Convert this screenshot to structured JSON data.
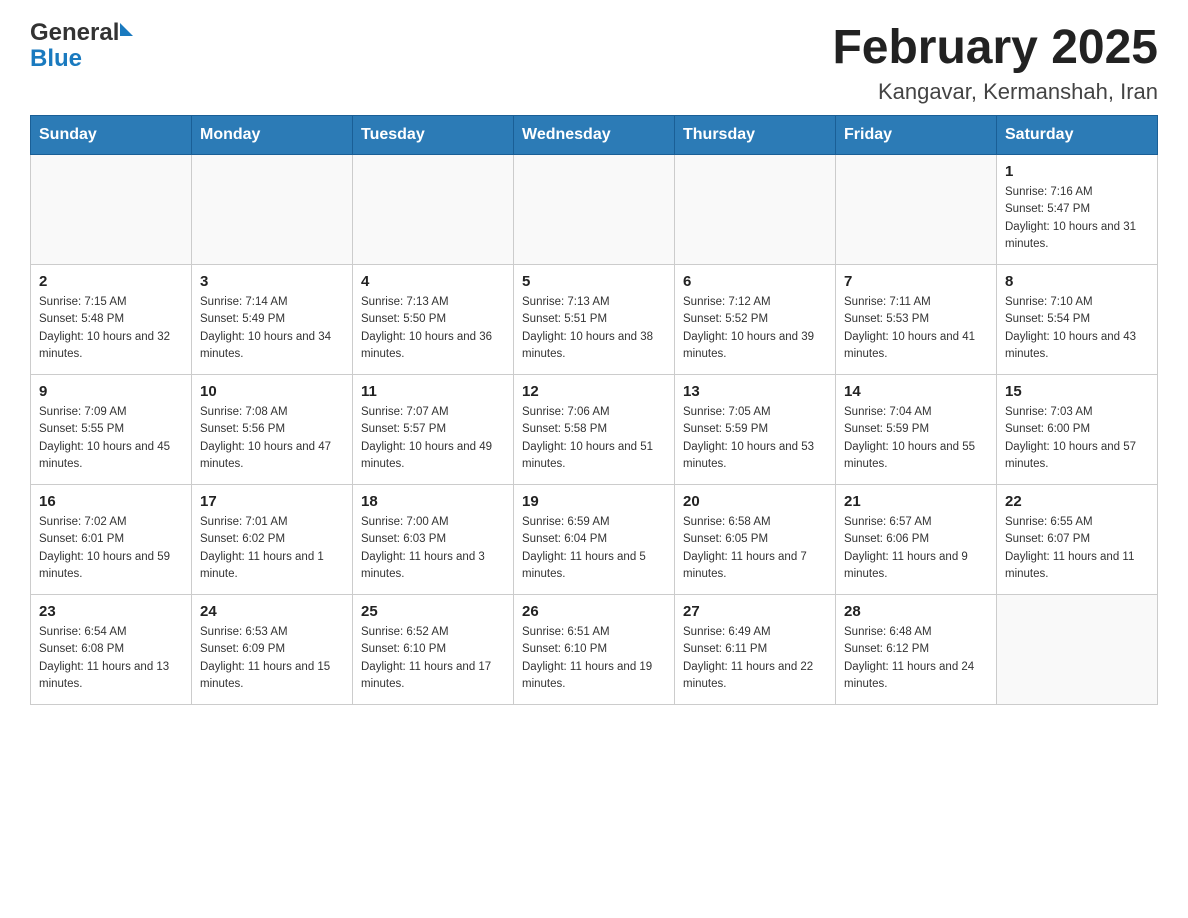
{
  "header": {
    "logo_line1": "General",
    "logo_line2": "Blue",
    "title": "February 2025",
    "subtitle": "Kangavar, Kermanshah, Iran"
  },
  "calendar": {
    "days_of_week": [
      "Sunday",
      "Monday",
      "Tuesday",
      "Wednesday",
      "Thursday",
      "Friday",
      "Saturday"
    ],
    "weeks": [
      [
        {
          "day": "",
          "info": ""
        },
        {
          "day": "",
          "info": ""
        },
        {
          "day": "",
          "info": ""
        },
        {
          "day": "",
          "info": ""
        },
        {
          "day": "",
          "info": ""
        },
        {
          "day": "",
          "info": ""
        },
        {
          "day": "1",
          "info": "Sunrise: 7:16 AM\nSunset: 5:47 PM\nDaylight: 10 hours and 31 minutes."
        }
      ],
      [
        {
          "day": "2",
          "info": "Sunrise: 7:15 AM\nSunset: 5:48 PM\nDaylight: 10 hours and 32 minutes."
        },
        {
          "day": "3",
          "info": "Sunrise: 7:14 AM\nSunset: 5:49 PM\nDaylight: 10 hours and 34 minutes."
        },
        {
          "day": "4",
          "info": "Sunrise: 7:13 AM\nSunset: 5:50 PM\nDaylight: 10 hours and 36 minutes."
        },
        {
          "day": "5",
          "info": "Sunrise: 7:13 AM\nSunset: 5:51 PM\nDaylight: 10 hours and 38 minutes."
        },
        {
          "day": "6",
          "info": "Sunrise: 7:12 AM\nSunset: 5:52 PM\nDaylight: 10 hours and 39 minutes."
        },
        {
          "day": "7",
          "info": "Sunrise: 7:11 AM\nSunset: 5:53 PM\nDaylight: 10 hours and 41 minutes."
        },
        {
          "day": "8",
          "info": "Sunrise: 7:10 AM\nSunset: 5:54 PM\nDaylight: 10 hours and 43 minutes."
        }
      ],
      [
        {
          "day": "9",
          "info": "Sunrise: 7:09 AM\nSunset: 5:55 PM\nDaylight: 10 hours and 45 minutes."
        },
        {
          "day": "10",
          "info": "Sunrise: 7:08 AM\nSunset: 5:56 PM\nDaylight: 10 hours and 47 minutes."
        },
        {
          "day": "11",
          "info": "Sunrise: 7:07 AM\nSunset: 5:57 PM\nDaylight: 10 hours and 49 minutes."
        },
        {
          "day": "12",
          "info": "Sunrise: 7:06 AM\nSunset: 5:58 PM\nDaylight: 10 hours and 51 minutes."
        },
        {
          "day": "13",
          "info": "Sunrise: 7:05 AM\nSunset: 5:59 PM\nDaylight: 10 hours and 53 minutes."
        },
        {
          "day": "14",
          "info": "Sunrise: 7:04 AM\nSunset: 5:59 PM\nDaylight: 10 hours and 55 minutes."
        },
        {
          "day": "15",
          "info": "Sunrise: 7:03 AM\nSunset: 6:00 PM\nDaylight: 10 hours and 57 minutes."
        }
      ],
      [
        {
          "day": "16",
          "info": "Sunrise: 7:02 AM\nSunset: 6:01 PM\nDaylight: 10 hours and 59 minutes."
        },
        {
          "day": "17",
          "info": "Sunrise: 7:01 AM\nSunset: 6:02 PM\nDaylight: 11 hours and 1 minute."
        },
        {
          "day": "18",
          "info": "Sunrise: 7:00 AM\nSunset: 6:03 PM\nDaylight: 11 hours and 3 minutes."
        },
        {
          "day": "19",
          "info": "Sunrise: 6:59 AM\nSunset: 6:04 PM\nDaylight: 11 hours and 5 minutes."
        },
        {
          "day": "20",
          "info": "Sunrise: 6:58 AM\nSunset: 6:05 PM\nDaylight: 11 hours and 7 minutes."
        },
        {
          "day": "21",
          "info": "Sunrise: 6:57 AM\nSunset: 6:06 PM\nDaylight: 11 hours and 9 minutes."
        },
        {
          "day": "22",
          "info": "Sunrise: 6:55 AM\nSunset: 6:07 PM\nDaylight: 11 hours and 11 minutes."
        }
      ],
      [
        {
          "day": "23",
          "info": "Sunrise: 6:54 AM\nSunset: 6:08 PM\nDaylight: 11 hours and 13 minutes."
        },
        {
          "day": "24",
          "info": "Sunrise: 6:53 AM\nSunset: 6:09 PM\nDaylight: 11 hours and 15 minutes."
        },
        {
          "day": "25",
          "info": "Sunrise: 6:52 AM\nSunset: 6:10 PM\nDaylight: 11 hours and 17 minutes."
        },
        {
          "day": "26",
          "info": "Sunrise: 6:51 AM\nSunset: 6:10 PM\nDaylight: 11 hours and 19 minutes."
        },
        {
          "day": "27",
          "info": "Sunrise: 6:49 AM\nSunset: 6:11 PM\nDaylight: 11 hours and 22 minutes."
        },
        {
          "day": "28",
          "info": "Sunrise: 6:48 AM\nSunset: 6:12 PM\nDaylight: 11 hours and 24 minutes."
        },
        {
          "day": "",
          "info": ""
        }
      ]
    ]
  }
}
